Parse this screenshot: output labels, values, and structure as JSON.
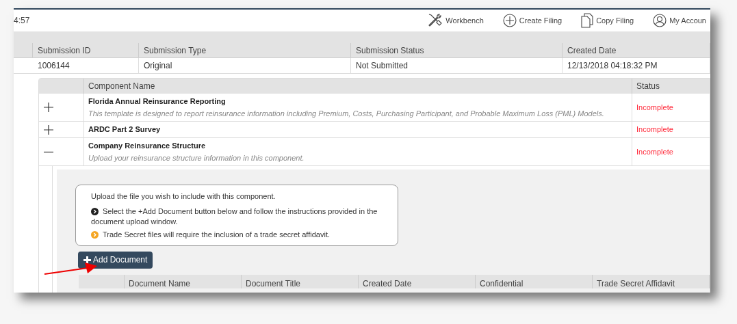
{
  "header": {
    "clock": "4:57",
    "nav": [
      {
        "kind": "tools",
        "label": "Workbench"
      },
      {
        "kind": "plus",
        "label": "Create Filing"
      },
      {
        "kind": "copy",
        "label": "Copy Filing"
      },
      {
        "kind": "user",
        "label": "My Accoun"
      }
    ]
  },
  "submission_table": {
    "columns": [
      "Submission ID",
      "Submission Type",
      "Submission Status",
      "Created Date"
    ],
    "rows": [
      {
        "cells": [
          "1006144",
          "Original",
          "Not Submitted",
          "12/13/2018 04:18:32 PM"
        ]
      }
    ]
  },
  "component_table": {
    "columns": [
      "Component Name",
      "Status"
    ],
    "rows": [
      {
        "name": "Florida Annual Reinsurance Reporting",
        "description": "This template is designed to report reinsurance information including Premium, Costs, Purchasing Participant, and Probable Maximum Loss (PML) Models.",
        "status": "Incomplete",
        "expanded": false
      },
      {
        "name": "ARDC Part 2 Survey",
        "status": "Incomplete",
        "expanded": false
      },
      {
        "name": "Company Reinsurance Structure",
        "description": "Upload your reinsurance structure information in this component.",
        "status": "Incomplete",
        "expanded": true
      }
    ]
  },
  "upload_panel": {
    "intro": "Upload the file you wish to include with this component.",
    "instructions": [
      {
        "text": "Select the +Add Document button below and follow the instructions provided in the document upload window.",
        "color": "#222222"
      },
      {
        "text": "Trade Secret files will require the inclusion of a trade secret affidavit.",
        "color": "#f5a623"
      }
    ],
    "add_button": "Add Document",
    "document_columns": [
      "Document Name",
      "Document Title",
      "Created Date",
      "Confidential",
      "Trade Secret Affidavit"
    ]
  }
}
